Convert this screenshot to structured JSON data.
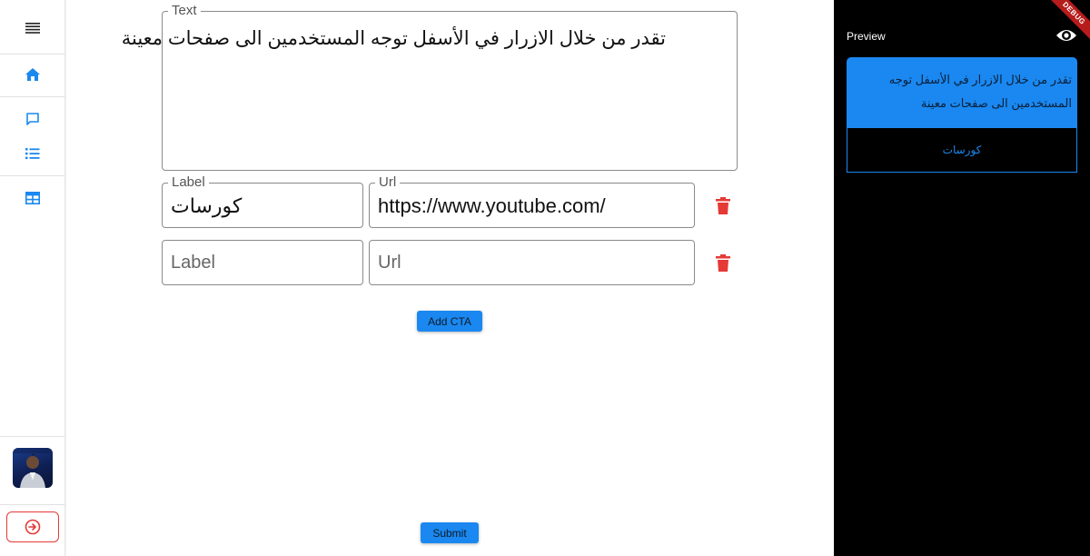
{
  "sidebar": {
    "items": [
      {
        "icon": "menu-icon"
      },
      {
        "icon": "home-icon"
      },
      {
        "icon": "chat-icon"
      },
      {
        "icon": "list-icon"
      },
      {
        "icon": "table-icon"
      }
    ],
    "avatar_icon": "user-avatar",
    "logout_icon": "logout-arrow-icon"
  },
  "form": {
    "text_label": "Text",
    "text_value": "تقدر من خلال الازرار في الأسفل توجه المستخدمين الى صفحات معينة",
    "ctas": [
      {
        "label_caption": "Label",
        "label_value": "كورسات",
        "url_caption": "Url",
        "url_value": "https://www.youtube.com/"
      },
      {
        "label_placeholder": "Label",
        "url_placeholder": "Url"
      }
    ],
    "add_cta": "Add CTA",
    "submit": "Submit"
  },
  "preview": {
    "title": "Preview",
    "message": "تقدر من خلال الازرار في الأسفل توجه المستخدمين الى صفحات معينة",
    "cta_label": "كورسات",
    "debug_banner": "DEBUG"
  },
  "colors": {
    "accent": "#1a88f0",
    "danger": "#e53935",
    "preview_bg": "#000000"
  }
}
